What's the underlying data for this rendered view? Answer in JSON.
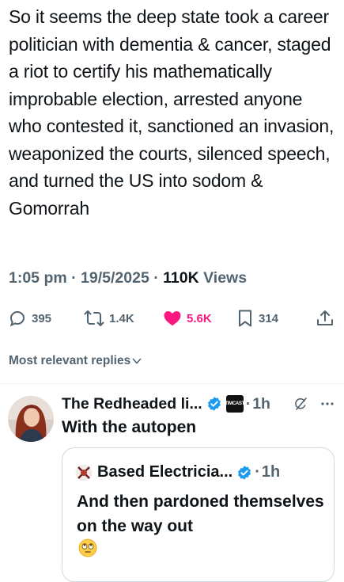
{
  "post": {
    "text": "So it seems the deep state took a career politician with dementia & cancer, staged a riot to certify his mathematically improbable election, arrested anyone who contested it, sanctioned an invasion, weaponized the courts, silenced speech, and turned the US into sodom & Gomorrah",
    "time": "1:05 pm",
    "date": "19/5/2025",
    "views": "110K",
    "views_label": "Views",
    "separator": "·"
  },
  "actions": {
    "replies": "395",
    "reposts": "1.4K",
    "likes": "5.6K",
    "bookmarks": "314"
  },
  "replies_filter": {
    "label": "Most relevant replies"
  },
  "reply": {
    "author": "The Redheaded li...",
    "affiliation_badge": "TIMCAST",
    "time": "1h",
    "separator": "·",
    "text": "With the autopen",
    "quote": {
      "author": "Based Electricia...",
      "time": "1h",
      "separator": "·",
      "text": "And then pardoned themselves on the way out"
    }
  },
  "colors": {
    "accent_blue": "#1d9bf0",
    "like_pink": "#f91880",
    "muted": "#536471"
  }
}
